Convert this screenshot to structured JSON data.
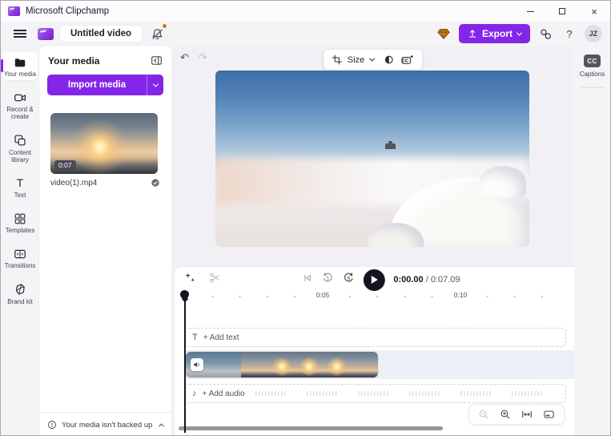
{
  "titlebar": {
    "app_title": "Microsoft Clipchamp"
  },
  "toolbar": {
    "project_name": "Untitled video",
    "export_label": "Export",
    "help_label": "?",
    "avatar_initials": "JZ"
  },
  "sidebar": {
    "items": [
      {
        "label": "Your media"
      },
      {
        "label": "Record & create"
      },
      {
        "label": "Content library"
      },
      {
        "label": "Text"
      },
      {
        "label": "Templates"
      },
      {
        "label": "Transitions"
      },
      {
        "label": "Brand kit"
      }
    ]
  },
  "media_panel": {
    "title": "Your media",
    "import_label": "Import media",
    "clip": {
      "duration": "0:07",
      "filename": "video(1).mp4"
    },
    "backup_notice": "Your media isn't backed up"
  },
  "preview_toolbar": {
    "size_label": "Size"
  },
  "transport": {
    "current_time": "0:00.00",
    "separator": " / ",
    "total_time": "0:07.09"
  },
  "timeline": {
    "ruler_labels": [
      "0:05",
      "0:10"
    ],
    "text_track_label": "+ Add text",
    "audio_track_label": "+ Add audio"
  },
  "captions_panel": {
    "icon_text": "CC",
    "label": "Captions"
  },
  "icons": {
    "undo": "↶",
    "redo": "↷",
    "text_glyph": "T",
    "music_note": "♪"
  },
  "colors": {
    "accent": "#8326e9",
    "play_button": "#16151f",
    "notification": "#c47a1e"
  }
}
